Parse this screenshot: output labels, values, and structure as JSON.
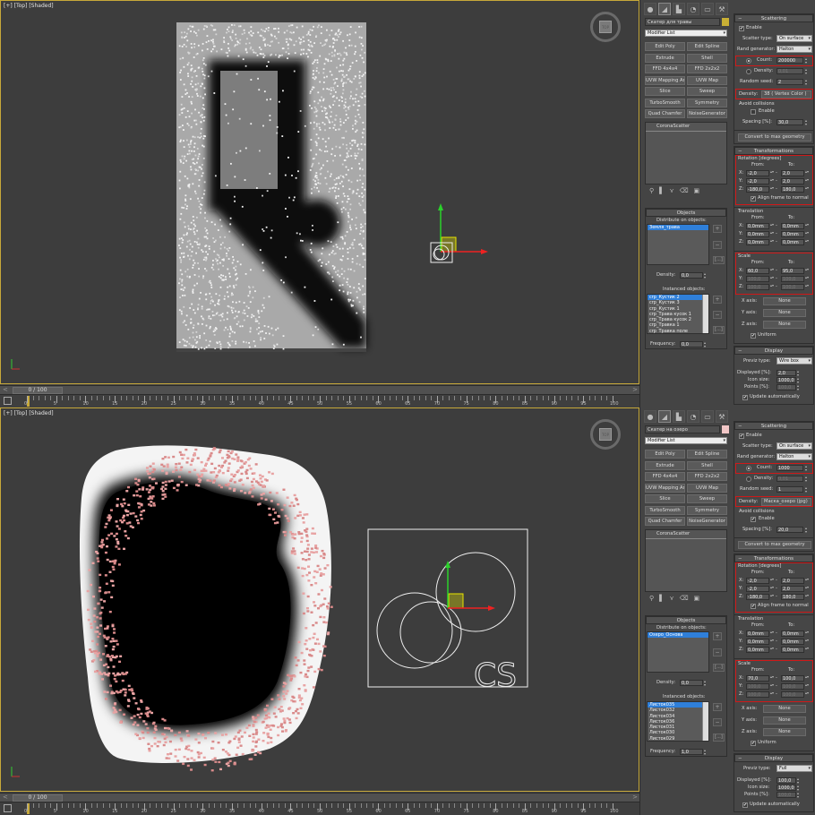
{
  "top": {
    "viewport_label": "[+] [Top] [Shaded]",
    "viewcube_label": "TOP",
    "timeline": {
      "frame": "0 / 100",
      "left_btn": "<",
      "right_btn": ">"
    },
    "ruler_ticks": [
      "0",
      "5",
      "10",
      "15",
      "20",
      "25",
      "30",
      "35",
      "40",
      "45",
      "50",
      "55",
      "60",
      "65",
      "70",
      "75",
      "80",
      "85",
      "90",
      "95",
      "100"
    ],
    "object_name": "Скатер для травы",
    "object_color": "#c9b035",
    "modifier_list": "Modifier List",
    "mod_buttons": [
      "Edit Poly",
      "Edit Spline",
      "Extrude",
      "Shell",
      "FFD 4x4x4",
      "FFD 2x2x2",
      "UVW Mapping Ar",
      "UVW Map",
      "Slice",
      "Sweep",
      "TurboSmooth",
      "Symmetry",
      "Quad Chamfer",
      "NoiseGenerator"
    ],
    "stack_item": "CoronaScatter",
    "objects": {
      "header": "Objects",
      "distribute_label": "Distribute on objects:",
      "distribute_items": [
        "Земля_трава"
      ],
      "density_label": "Density:",
      "density_value": "0,0",
      "instanced_label": "Instanced objects:",
      "instanced_items": [
        "crp_Кустик 2",
        "crp_Кустик 3",
        "crp_Кустик 1",
        "crp_Трава кусок 1",
        "crp_Трава кусок 2",
        "crp_Травка 1",
        "crp_Травка поле"
      ],
      "frequency_label": "Frequency:",
      "frequency_value": "0,0",
      "ellipsis": "[...]"
    },
    "scattering": {
      "header": "Scattering",
      "enable_label": "Enable",
      "scatter_type_label": "Scatter type:",
      "scatter_type_value": "On surface",
      "rand_gen_label": "Rand generator:",
      "rand_gen_value": "Halton",
      "count_label": "Count:",
      "count_value": "200000",
      "density_label": "Density:",
      "density_value": "0,01",
      "random_seed_label": "Random seed:",
      "random_seed_value": "2",
      "density_map_label": "Density:",
      "density_map_value": "38 ( Vertex Color )",
      "avoid_label": "Avoid collisions",
      "avoid_enable": "Enable",
      "spacing_label": "Spacing [%]:",
      "spacing_value": "30,0",
      "convert_btn": "Convert to max geometry"
    },
    "transformations": {
      "header": "Transformations",
      "rotation_label": "Rotation [degrees]",
      "from": "From:",
      "to": "To:",
      "rx_from": "-2,0",
      "rx_to": "2,0",
      "ry_from": "-2,0",
      "ry_to": "2,0",
      "rz_from": "-180,0",
      "rz_to": "180,0",
      "align_label": "Align frame to normal",
      "translation_label": "Translation",
      "tx_from": "0,0mm",
      "tx_to": "0,0mm",
      "ty_from": "0,0mm",
      "ty_to": "0,0mm",
      "tz_from": "0,0mm",
      "tz_to": "0,0mm",
      "scale_label": "Scale",
      "sx_from": "60,0",
      "sx_to": "95,0",
      "sy_from": "100,0",
      "sy_to": "100,0",
      "sz_from": "100,0",
      "sz_to": "100,0",
      "xaxis_label": "X axis:",
      "xaxis_value": "None",
      "yaxis_label": "Y axis:",
      "yaxis_value": "None",
      "zaxis_label": "Z axis:",
      "zaxis_value": "None",
      "uniform_label": "Uniform"
    },
    "display": {
      "header": "Display",
      "previz_label": "Previz type:",
      "previz_value": "Wire box",
      "displayed_label": "Displayed [%]:",
      "displayed_value": "2,0",
      "icon_size_label": "Icon size:",
      "icon_size_value": "1000,0",
      "points_label": "Points [%]:",
      "points_value": "100,0",
      "update_label": "Update automatically"
    }
  },
  "bottom": {
    "viewport_label": "[+] [Top] [Shaded]",
    "viewcube_label": "TOP",
    "timeline": {
      "frame": "0 / 100",
      "left_btn": "<",
      "right_btn": ">"
    },
    "ruler_ticks": [
      "0",
      "5",
      "10",
      "15",
      "20",
      "25",
      "30",
      "35",
      "40",
      "45",
      "50",
      "55",
      "60",
      "65",
      "70",
      "75",
      "80",
      "85",
      "90",
      "95",
      "100"
    ],
    "cs_label": "CS",
    "object_name": "Скатер на озеро",
    "object_color": "#f1c6c6",
    "modifier_list": "Modifier List",
    "mod_buttons": [
      "Edit Poly",
      "Edit Spline",
      "Extrude",
      "Shell",
      "FFD 4x4x4",
      "FFD 2x2x2",
      "UVW Mapping Ar",
      "UVW Map",
      "Slice",
      "Sweep",
      "TurboSmooth",
      "Symmetry",
      "Quad Chamfer",
      "NoiseGenerator"
    ],
    "stack_item": "CoronaScatter",
    "objects": {
      "header": "Objects",
      "distribute_label": "Distribute on objects:",
      "distribute_items": [
        "Озеро_Основа"
      ],
      "density_label": "Density:",
      "density_value": "0,0",
      "instanced_label": "Instanced objects:",
      "instanced_items": [
        "Листок035",
        "Листок032",
        "Листок034",
        "Листок036",
        "Листок031",
        "Листок030",
        "Листок029"
      ],
      "frequency_label": "Frequency:",
      "frequency_value": "1,0",
      "ellipsis": "[...]"
    },
    "scattering": {
      "header": "Scattering",
      "enable_label": "Enable",
      "scatter_type_label": "Scatter type:",
      "scatter_type_value": "On surface",
      "rand_gen_label": "Rand generator:",
      "rand_gen_value": "Halton",
      "count_label": "Count:",
      "count_value": "1000",
      "density_label": "Density:",
      "density_value": "0,01",
      "random_seed_label": "Random seed:",
      "random_seed_value": "1",
      "density_map_label": "Density:",
      "density_map_value": "Маска_озеро (jpg)",
      "avoid_label": "Avoid collisions",
      "avoid_enable": "Enable",
      "spacing_label": "Spacing [%]:",
      "spacing_value": "20,0",
      "convert_btn": "Convert to max geometry"
    },
    "transformations": {
      "header": "Transformations",
      "rotation_label": "Rotation [degrees]",
      "from": "From:",
      "to": "To:",
      "rx_from": "-2,0",
      "rx_to": "2,0",
      "ry_from": "-2,0",
      "ry_to": "2,0",
      "rz_from": "-180,0",
      "rz_to": "180,0",
      "align_label": "Align frame to normal",
      "translation_label": "Translation",
      "tx_from": "0,0mm",
      "tx_to": "0,0mm",
      "ty_from": "0,0mm",
      "ty_to": "0,0mm",
      "tz_from": "0,0mm",
      "tz_to": "0,0mm",
      "scale_label": "Scale",
      "sx_from": "70,0",
      "sx_to": "100,0",
      "sy_from": "100,0",
      "sy_to": "100,0",
      "sz_from": "100,0",
      "sz_to": "100,0",
      "xaxis_label": "X axis:",
      "xaxis_value": "None",
      "yaxis_label": "Y axis:",
      "yaxis_value": "None",
      "zaxis_label": "Z axis:",
      "zaxis_value": "None",
      "uniform_label": "Uniform"
    },
    "display": {
      "header": "Display",
      "previz_label": "Previz type:",
      "previz_value": "Full",
      "displayed_label": "Displayed [%]:",
      "displayed_value": "100,0",
      "icon_size_label": "Icon size:",
      "icon_size_value": "1000,0",
      "points_label": "Points [%]:",
      "points_value": "100,0",
      "update_label": "Update automatically"
    }
  },
  "colors": {
    "highlight": "#d01818",
    "viewport_border": "#c7a93a",
    "selection": "#2f7fd9"
  }
}
